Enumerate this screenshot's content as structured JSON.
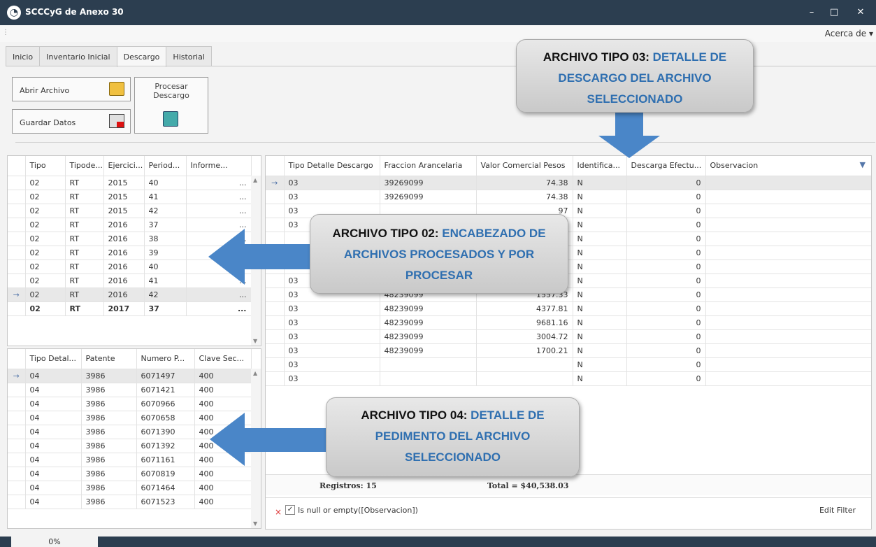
{
  "window": {
    "title": "SCCCyG de Anexo 30",
    "minimize_glyph": "–",
    "maximize_glyph": "□",
    "close_glyph": "✕",
    "titlebar_color": "#2c3e50"
  },
  "menu": {
    "about": "Acerca de ▾"
  },
  "tabs": [
    "Inicio",
    "Inventario Inicial",
    "Descargo",
    "Historial"
  ],
  "active_tab": "Descargo",
  "ribbon": {
    "open_file": "Abrir Archivo",
    "save_data": "Guardar Datos",
    "process_line1": "Procesar",
    "process_line2": "Descargo",
    "icons": [
      "folder-open-icon",
      "save-disk-icon",
      "process-icon"
    ]
  },
  "top_left_grid": {
    "columns": [
      "Tipo",
      "Tipode...",
      "Ejercici...",
      "Period...",
      "Informe..."
    ],
    "rows": [
      [
        "02",
        "RT",
        "2015",
        "40",
        "..."
      ],
      [
        "02",
        "RT",
        "2015",
        "41",
        "..."
      ],
      [
        "02",
        "RT",
        "2015",
        "42",
        "..."
      ],
      [
        "02",
        "RT",
        "2016",
        "37",
        "..."
      ],
      [
        "02",
        "RT",
        "2016",
        "38",
        "..."
      ],
      [
        "02",
        "RT",
        "2016",
        "39",
        "..."
      ],
      [
        "02",
        "RT",
        "2016",
        "40",
        "..."
      ],
      [
        "02",
        "RT",
        "2016",
        "41",
        "..."
      ],
      [
        "02",
        "RT",
        "2016",
        "42",
        "..."
      ],
      [
        "02",
        "RT",
        "2017",
        "37",
        "..."
      ]
    ],
    "selected_row": 8,
    "bold_row": 9
  },
  "bottom_left_grid": {
    "columns": [
      "Tipo Detal...",
      "Patente",
      "Numero P...",
      "Clave Sec..."
    ],
    "rows": [
      [
        "04",
        "3986",
        "6071497",
        "400"
      ],
      [
        "04",
        "3986",
        "6071421",
        "400"
      ],
      [
        "04",
        "3986",
        "6070966",
        "400"
      ],
      [
        "04",
        "3986",
        "6070658",
        "400"
      ],
      [
        "04",
        "3986",
        "6071390",
        "400"
      ],
      [
        "04",
        "3986",
        "6071392",
        "400"
      ],
      [
        "04",
        "3986",
        "6071161",
        "400"
      ],
      [
        "04",
        "3986",
        "6070819",
        "400"
      ],
      [
        "04",
        "3986",
        "6071464",
        "400"
      ],
      [
        "04",
        "3986",
        "6071523",
        "400"
      ]
    ],
    "selected_row": 0
  },
  "right_grid": {
    "columns": [
      "Tipo Detalle Descargo",
      "Fraccion Arancelaria",
      "Valor Comercial Pesos",
      "Identifica...",
      "Descarga Efectu...",
      "Observacion"
    ],
    "rows": [
      [
        "03",
        "39269099",
        "74.38",
        "N",
        "0",
        ""
      ],
      [
        "03",
        "39269099",
        "74.38",
        "N",
        "0",
        ""
      ],
      [
        "03",
        "",
        "97",
        "N",
        "0",
        ""
      ],
      [
        "03",
        "",
        "7",
        "N",
        "0",
        ""
      ],
      [
        "",
        "",
        "4",
        "N",
        "0",
        ""
      ],
      [
        "",
        "",
        "3",
        "N",
        "0",
        ""
      ],
      [
        "03",
        "",
        "3",
        "N",
        "0",
        ""
      ],
      [
        "03",
        "48239099",
        "1676.47",
        "N",
        "0",
        ""
      ],
      [
        "03",
        "48239099",
        "1557.33",
        "N",
        "0",
        ""
      ],
      [
        "03",
        "48239099",
        "4377.81",
        "N",
        "0",
        ""
      ],
      [
        "03",
        "48239099",
        "9681.16",
        "N",
        "0",
        ""
      ],
      [
        "03",
        "48239099",
        "3004.72",
        "N",
        "0",
        ""
      ],
      [
        "03",
        "48239099",
        "1700.21",
        "N",
        "0",
        ""
      ],
      [
        "03",
        "",
        "",
        "N",
        "0",
        ""
      ],
      [
        "03",
        "",
        "",
        "N",
        "0",
        ""
      ]
    ],
    "selected_row": 0,
    "footer_count": "Registros: 15",
    "footer_total": "Total = $40,538.03",
    "filter_text": "Is null or empty([Observacion])",
    "edit_filter": "Edit Filter"
  },
  "callouts": {
    "c03_bold": "ARCHIVO TIPO 03: ",
    "c03_hl": "DETALLE DE DESCARGO DEL ARCHIVO SELECCIONADO",
    "c02_bold": "ARCHIVO TIPO 02: ",
    "c02_hl": "ENCABEZADO DE ARCHIVOS PROCESADOS Y POR PROCESAR",
    "c04_bold": "ARCHIVO TIPO 04: ",
    "c04_hl": "DETALLE DE PEDIMENTO DEL ARCHIVO SELECCIONADO",
    "arrow_color": "#4a86c8",
    "highlight_color": "#2f6fb0"
  },
  "status": {
    "progress": "0%"
  }
}
